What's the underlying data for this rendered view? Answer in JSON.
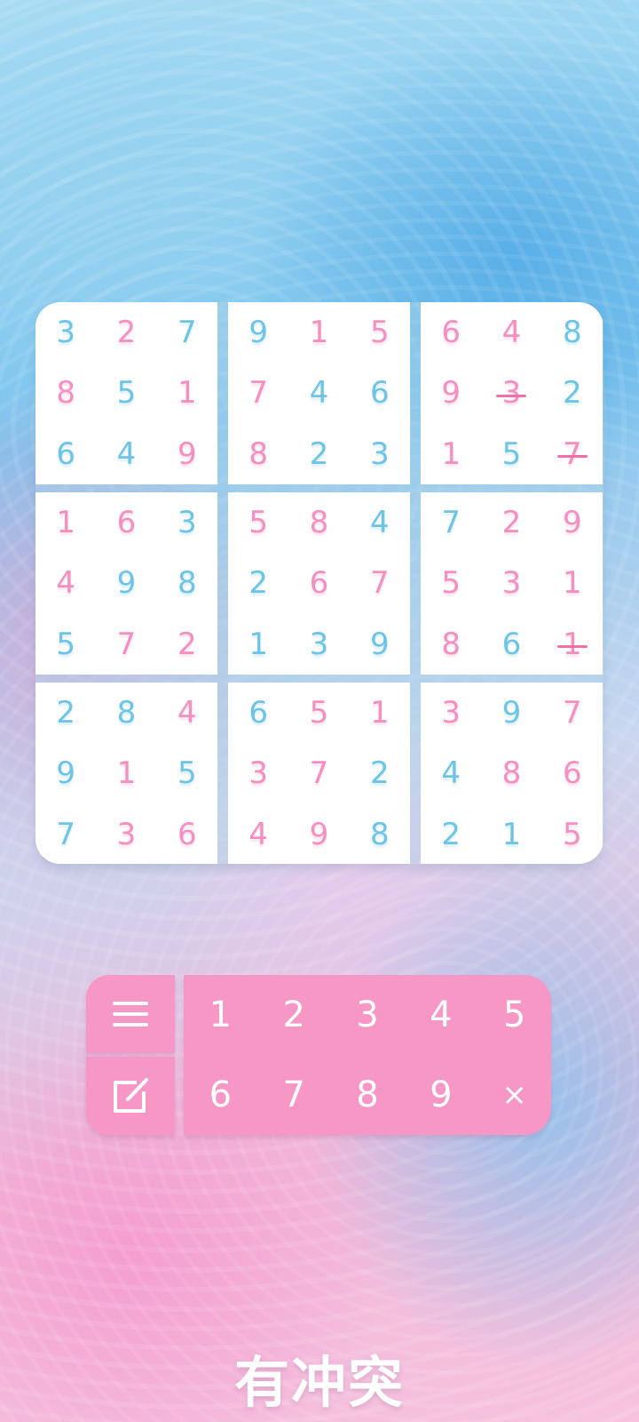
{
  "colors": {
    "given_digit": "#6ec4e6",
    "filled_digit": "#f58fbf",
    "pad": "#f797c6",
    "conflict_strike": "#f26fa8"
  },
  "board": {
    "boxes": [
      [
        {
          "v": "3",
          "c": "blue"
        },
        {
          "v": "2",
          "c": "pink"
        },
        {
          "v": "7",
          "c": "blue"
        },
        {
          "v": "8",
          "c": "pink"
        },
        {
          "v": "5",
          "c": "blue"
        },
        {
          "v": "1",
          "c": "pink"
        },
        {
          "v": "6",
          "c": "blue"
        },
        {
          "v": "4",
          "c": "blue"
        },
        {
          "v": "9",
          "c": "pink"
        }
      ],
      [
        {
          "v": "9",
          "c": "blue"
        },
        {
          "v": "1",
          "c": "pink"
        },
        {
          "v": "5",
          "c": "pink"
        },
        {
          "v": "7",
          "c": "pink"
        },
        {
          "v": "4",
          "c": "blue"
        },
        {
          "v": "6",
          "c": "blue"
        },
        {
          "v": "8",
          "c": "pink"
        },
        {
          "v": "2",
          "c": "blue"
        },
        {
          "v": "3",
          "c": "blue"
        }
      ],
      [
        {
          "v": "6",
          "c": "pink"
        },
        {
          "v": "4",
          "c": "pink"
        },
        {
          "v": "8",
          "c": "blue"
        },
        {
          "v": "9",
          "c": "pink"
        },
        {
          "v": "3",
          "c": "pink",
          "conflict": true
        },
        {
          "v": "2",
          "c": "blue"
        },
        {
          "v": "1",
          "c": "pink"
        },
        {
          "v": "5",
          "c": "blue"
        },
        {
          "v": "7",
          "c": "pink",
          "conflict": true
        }
      ],
      [
        {
          "v": "1",
          "c": "pink"
        },
        {
          "v": "6",
          "c": "pink"
        },
        {
          "v": "3",
          "c": "blue"
        },
        {
          "v": "4",
          "c": "pink"
        },
        {
          "v": "9",
          "c": "blue"
        },
        {
          "v": "8",
          "c": "blue"
        },
        {
          "v": "5",
          "c": "blue"
        },
        {
          "v": "7",
          "c": "pink"
        },
        {
          "v": "2",
          "c": "pink"
        }
      ],
      [
        {
          "v": "5",
          "c": "pink"
        },
        {
          "v": "8",
          "c": "pink"
        },
        {
          "v": "4",
          "c": "blue"
        },
        {
          "v": "2",
          "c": "blue"
        },
        {
          "v": "6",
          "c": "pink"
        },
        {
          "v": "7",
          "c": "pink"
        },
        {
          "v": "1",
          "c": "blue"
        },
        {
          "v": "3",
          "c": "blue"
        },
        {
          "v": "9",
          "c": "blue"
        }
      ],
      [
        {
          "v": "7",
          "c": "blue"
        },
        {
          "v": "2",
          "c": "pink"
        },
        {
          "v": "9",
          "c": "pink"
        },
        {
          "v": "5",
          "c": "pink"
        },
        {
          "v": "3",
          "c": "pink"
        },
        {
          "v": "1",
          "c": "pink"
        },
        {
          "v": "8",
          "c": "pink"
        },
        {
          "v": "6",
          "c": "blue"
        },
        {
          "v": "1",
          "c": "pink",
          "conflict": true
        }
      ],
      [
        {
          "v": "2",
          "c": "blue"
        },
        {
          "v": "8",
          "c": "blue"
        },
        {
          "v": "4",
          "c": "pink"
        },
        {
          "v": "9",
          "c": "blue"
        },
        {
          "v": "1",
          "c": "pink"
        },
        {
          "v": "5",
          "c": "blue"
        },
        {
          "v": "7",
          "c": "blue"
        },
        {
          "v": "3",
          "c": "pink"
        },
        {
          "v": "6",
          "c": "pink"
        }
      ],
      [
        {
          "v": "6",
          "c": "blue"
        },
        {
          "v": "5",
          "c": "pink"
        },
        {
          "v": "1",
          "c": "pink"
        },
        {
          "v": "3",
          "c": "pink"
        },
        {
          "v": "7",
          "c": "pink"
        },
        {
          "v": "2",
          "c": "blue"
        },
        {
          "v": "4",
          "c": "pink"
        },
        {
          "v": "9",
          "c": "pink"
        },
        {
          "v": "8",
          "c": "blue"
        }
      ],
      [
        {
          "v": "3",
          "c": "pink"
        },
        {
          "v": "9",
          "c": "blue"
        },
        {
          "v": "7",
          "c": "pink"
        },
        {
          "v": "4",
          "c": "blue"
        },
        {
          "v": "8",
          "c": "pink"
        },
        {
          "v": "6",
          "c": "pink"
        },
        {
          "v": "2",
          "c": "blue"
        },
        {
          "v": "1",
          "c": "blue"
        },
        {
          "v": "5",
          "c": "pink"
        }
      ]
    ]
  },
  "pad": {
    "menu_icon": "menu-icon",
    "note_icon": "edit-note-icon",
    "keys": [
      "1",
      "2",
      "3",
      "4",
      "5",
      "6",
      "7",
      "8",
      "9",
      "×"
    ]
  },
  "status": {
    "text": "有冲突"
  }
}
